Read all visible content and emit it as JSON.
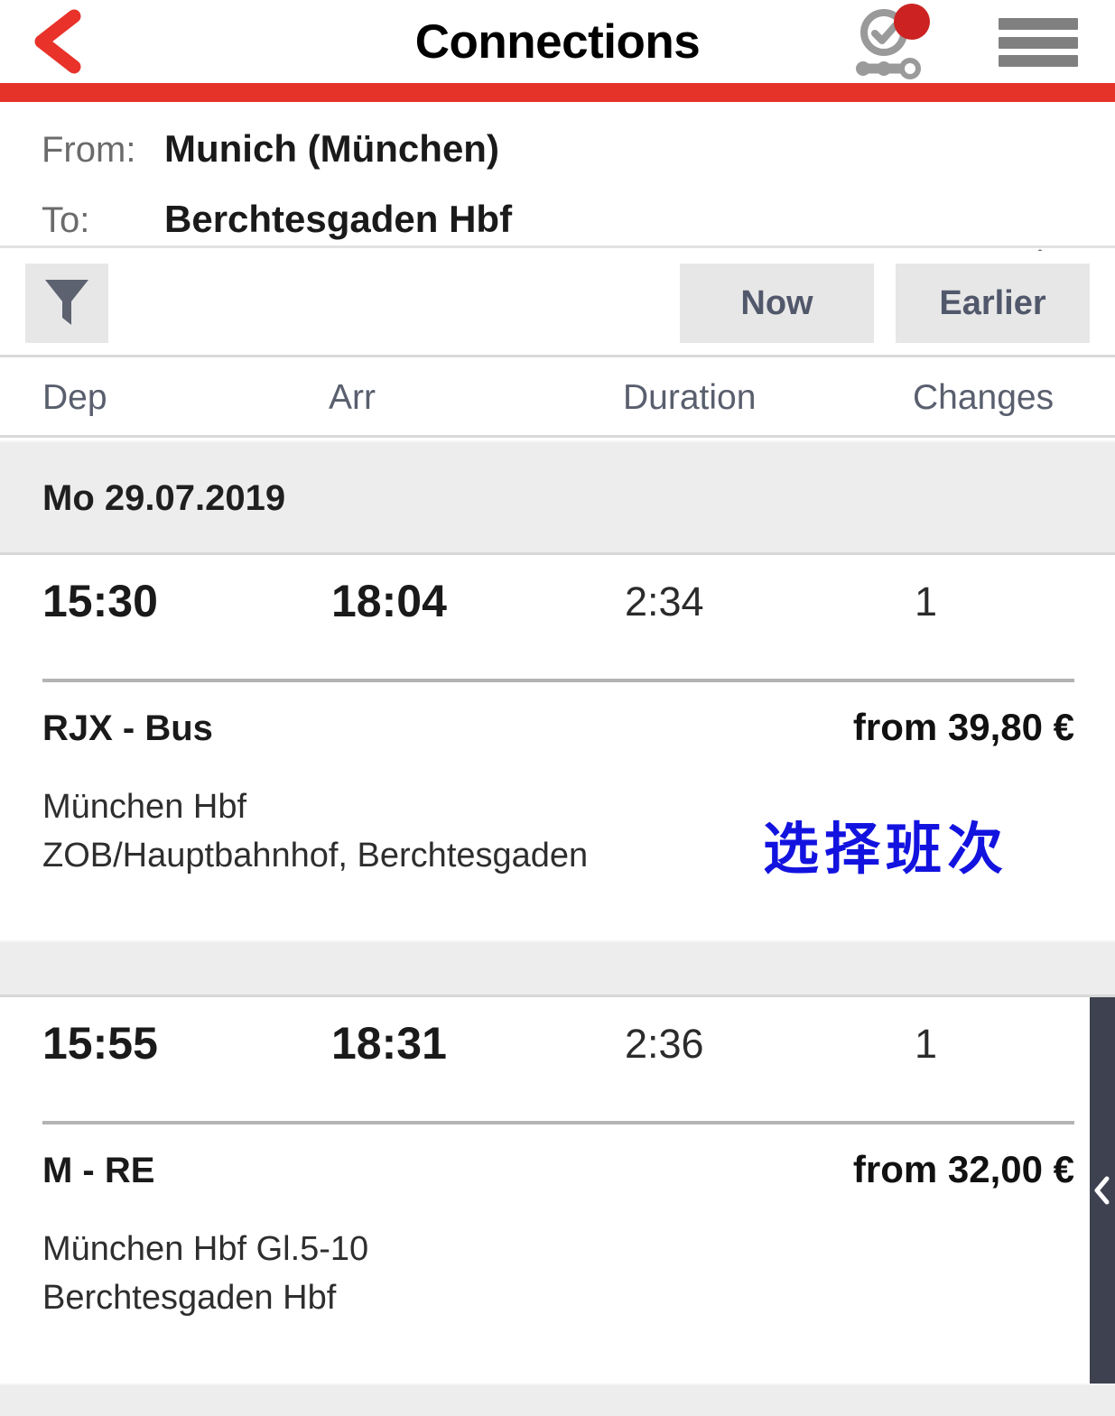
{
  "header": {
    "title": "Connections",
    "back_icon": "chevron-left-icon",
    "status_icon": "journey-status-icon",
    "menu_icon": "hamburger-menu-icon",
    "notification_badge": true,
    "accent_color": "#e63329"
  },
  "route": {
    "from_label": "From:",
    "from_value": "Munich (München)",
    "to_label": "To:",
    "to_value": "Berchtesgaden Hbf",
    "favorite_icon": "star-outline-icon"
  },
  "actions": {
    "filter_icon": "filter-funnel-icon",
    "now_label": "Now",
    "earlier_label": "Earlier"
  },
  "columns": {
    "dep": "Dep",
    "arr": "Arr",
    "duration": "Duration",
    "changes": "Changes"
  },
  "date_group": {
    "label": "Mo 29.07.2019"
  },
  "connections": [
    {
      "dep": "15:30",
      "arr": "18:04",
      "duration": "2:34",
      "changes": "1",
      "product": "RJX - Bus",
      "price": "from 39,80 €",
      "origin_stop": "München Hbf",
      "destination_stop": "ZOB/Hauptbahnhof, Berchtesgaden"
    },
    {
      "dep": "15:55",
      "arr": "18:31",
      "duration": "2:36",
      "changes": "1",
      "product": "M - RE",
      "price": "from 32,00 €",
      "origin_stop": "München Hbf Gl.5-10",
      "destination_stop": "Berchtesgaden Hbf"
    }
  ],
  "annotation": {
    "text": "选择班次",
    "color": "#1313e0"
  },
  "drawer": {
    "handle_icon": "chevron-left-icon",
    "color": "#3e4150"
  }
}
